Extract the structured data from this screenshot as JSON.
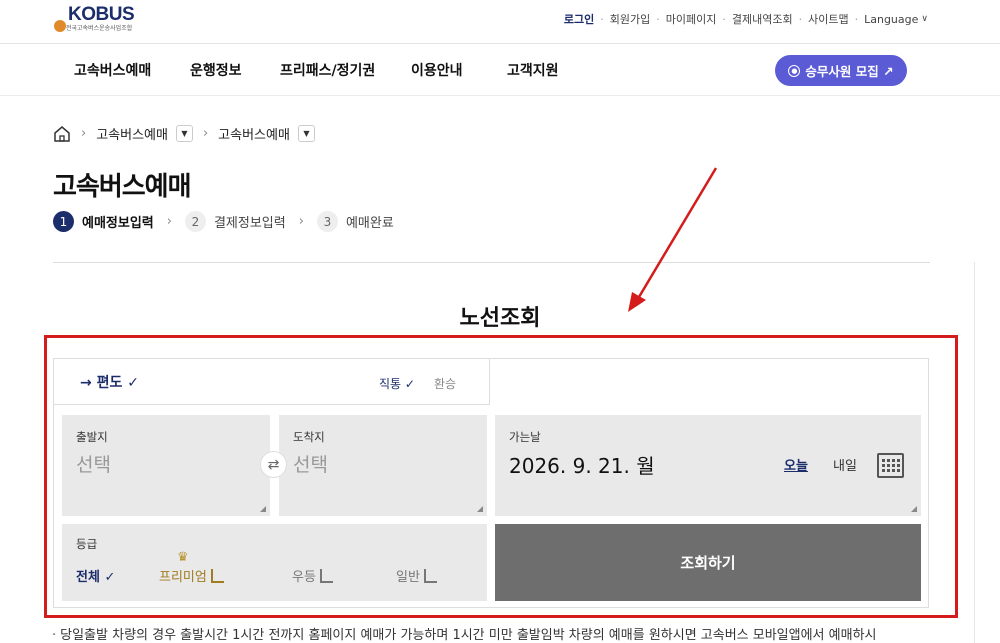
{
  "logo": {
    "name": "KOBUS",
    "subtitle": "전국고속버스운송사업조합"
  },
  "topnav": {
    "login": "로그인",
    "signup": "회원가입",
    "mypage": "마이페이지",
    "history": "결제내역조회",
    "sitemap": "사이트맵",
    "language": "Language"
  },
  "mainnav": [
    "고속버스예매",
    "운행정보",
    "프리패스/정기권",
    "이용안내",
    "고객지원"
  ],
  "recruit_button": "승무사원 모집 ↗",
  "breadcrumb": {
    "item1": "고속버스예매",
    "item2": "고속버스예매"
  },
  "page_title": "고속버스예매",
  "steps": [
    {
      "num": "1",
      "label": "예매정보입력"
    },
    {
      "num": "2",
      "label": "결제정보입력"
    },
    {
      "num": "3",
      "label": "예매완료"
    }
  ],
  "section_title": "노선조회",
  "trip": {
    "oneway": "→ 편도 ✓",
    "direct": "직통 ✓",
    "transfer": "환승"
  },
  "departure": {
    "label": "출발지",
    "value": "선택"
  },
  "arrival": {
    "label": "도착지",
    "value": "선택"
  },
  "date": {
    "label": "가는날",
    "value": "2026. 9. 21. 월",
    "today": "오늘",
    "tomorrow": "내일"
  },
  "grade": {
    "label": "등급",
    "all": "전체 ✓",
    "premium": "프리미엄",
    "excellent": "우등",
    "general": "일반"
  },
  "search_button": "조회하기",
  "notice": "당일출발 차량의 경우 출발시간 1시간 전까지 홈페이지 예매가 가능하며 1시간 미만 출발임박 차량의 예매를 원하시면 고속버스 모바일앱에서 예매하시",
  "colors": {
    "brand": "#1c2d6b",
    "accent": "#5b5bd6",
    "highlight": "#d41c1c",
    "premium": "#a07c1f"
  }
}
